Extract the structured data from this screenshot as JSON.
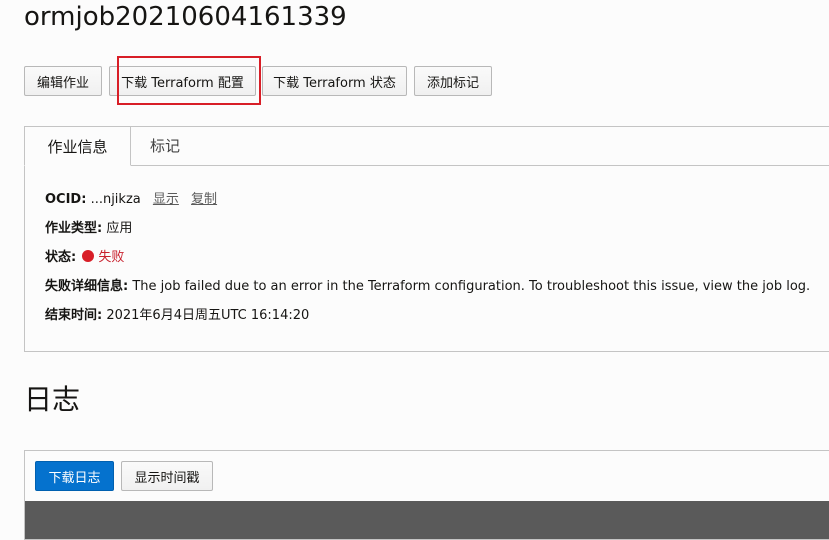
{
  "page": {
    "title": "ormjob20210604161339"
  },
  "toolbar": {
    "edit_label": "编辑作业",
    "download_config_label": "下载 Terraform 配置",
    "download_state_label": "下载 Terraform 状态",
    "add_tag_label": "添加标记"
  },
  "tabs": [
    {
      "label": "作业信息",
      "active": true
    },
    {
      "label": "标记",
      "active": false
    }
  ],
  "job_info": {
    "ocid_label": "OCID:",
    "ocid_value": "...njikza",
    "ocid_show": "显示",
    "ocid_copy": "复制",
    "type_label": "作业类型:",
    "type_value": "应用",
    "status_label": "状态:",
    "status_value": "失败",
    "failure_label": "失败详细信息:",
    "failure_value": "The job failed due to an error in the Terraform configuration. To troubleshoot this issue, view the job log.",
    "end_label": "结束时间:",
    "end_value": "2021年6月4日周五UTC 16:14:20"
  },
  "logs": {
    "title": "日志",
    "download_label": "下载日志",
    "timestamp_label": "显示时间戳"
  },
  "colors": {
    "primary": "#0572ce",
    "error": "#d81e27",
    "highlight": "#d81e27",
    "log_bg": "#5a5a5a"
  }
}
